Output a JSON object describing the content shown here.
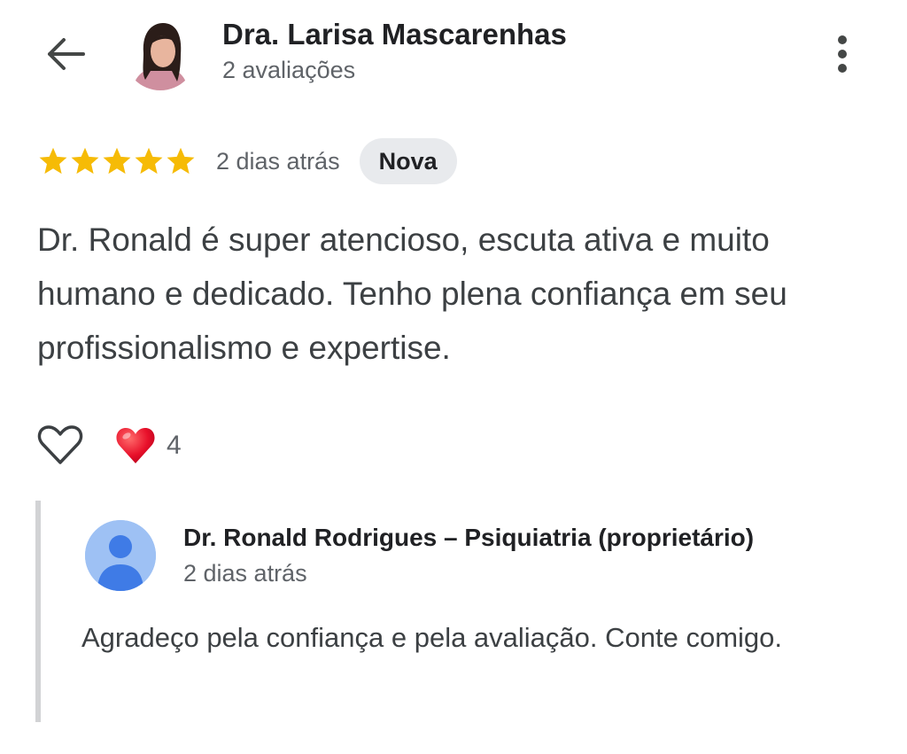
{
  "header": {
    "back_icon": "arrow-left-icon",
    "reviewer_name": "Dra. Larisa Mascarenhas",
    "reviewer_reviews_count": "2 avaliações",
    "menu_icon": "more-vertical-icon"
  },
  "review": {
    "rating": 5,
    "max_rating": 5,
    "star_color": "#f6bb06",
    "time": "2 dias atrás",
    "badge": "Nova",
    "text": "Dr. Ronald é super atencioso, escuta ativa e muito humano e dedicado. Tenho plena confiança em seu profissionalismo e expertise."
  },
  "actions": {
    "like_icon": "heart-outline-icon",
    "reaction_icon": "red-heart-emoji-icon",
    "reaction_count": "4"
  },
  "owner_reply": {
    "name": "Dr. Ronald Rodrigues – Psiquiatria (proprietário)",
    "time": "2 dias atrás",
    "text": "Agradeço pela confiança e pela avaliação. Conte comigo.",
    "avatar_icon": "default-user-avatar-icon",
    "avatar_color": "#9ec1f4"
  }
}
